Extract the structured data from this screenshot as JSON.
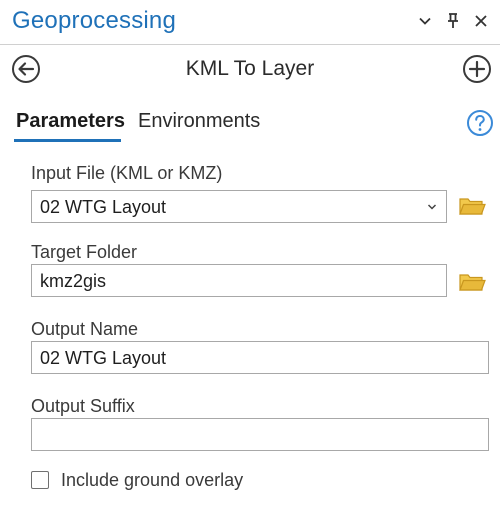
{
  "pane": {
    "title": "Geoprocessing"
  },
  "tool": {
    "title": "KML To Layer"
  },
  "tabs": {
    "parameters": "Parameters",
    "environments": "Environments"
  },
  "params": {
    "input_file": {
      "label": "Input  File (KML or KMZ)",
      "value": "02 WTG Layout"
    },
    "target_folder": {
      "label": "Target Folder",
      "value": "kmz2gis"
    },
    "output_name": {
      "label": "Output Name",
      "value": "02 WTG Layout"
    },
    "output_suffix": {
      "label": "Output Suffix",
      "value": ""
    }
  },
  "include_ground_overlay": {
    "label": "Include ground overlay",
    "checked": false
  },
  "colors": {
    "accent": "#1f71b8",
    "folder": "#e8b93a",
    "help": "#3b8ad8"
  },
  "icons": {
    "menu": "chevron-down-icon",
    "pin": "pin-icon",
    "close": "close-icon",
    "back": "back-arrow-icon",
    "add": "add-icon",
    "help": "help-icon",
    "folder": "folder-icon"
  }
}
